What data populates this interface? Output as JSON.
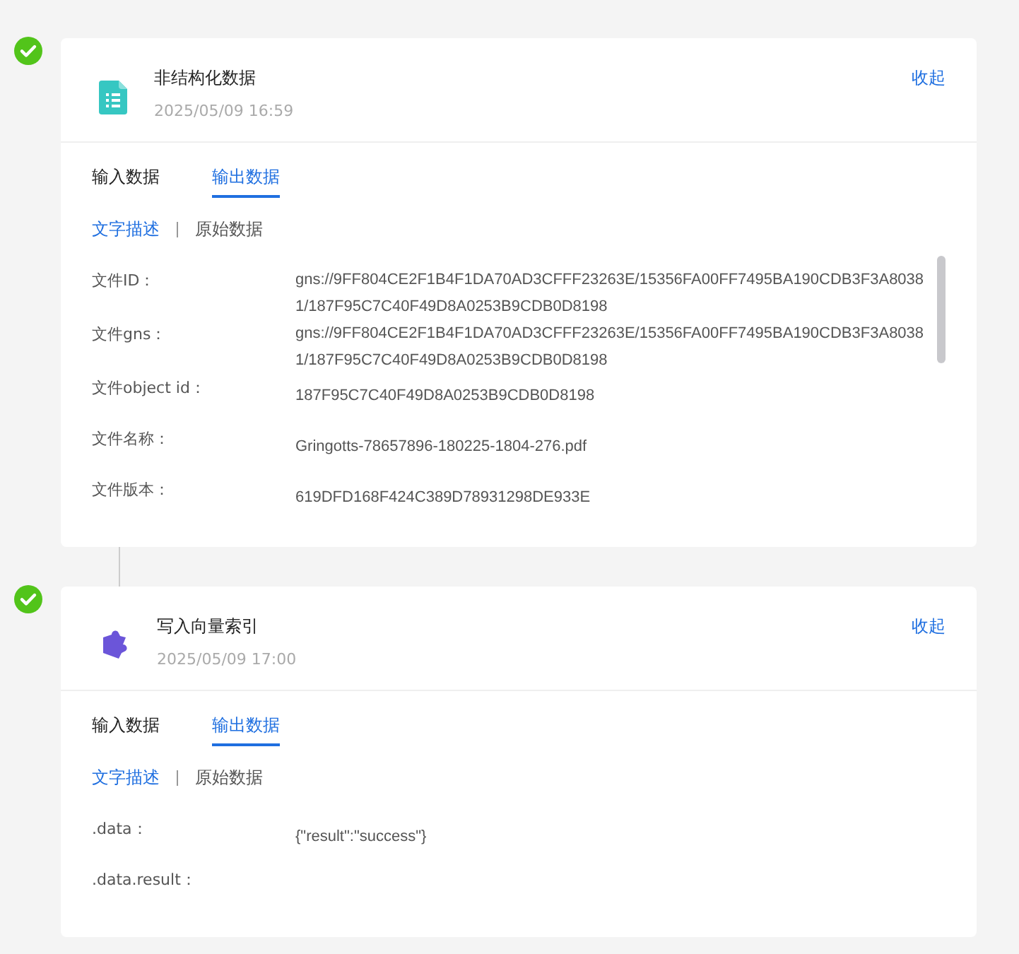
{
  "steps": [
    {
      "kind": "document",
      "title": "非结构化数据",
      "time": "2025/05/09 16:59",
      "toggle": "收起",
      "done": true,
      "tabs": [
        {
          "label": "输入数据",
          "selected": false
        },
        {
          "label": "输出数据",
          "selected": true
        }
      ],
      "subtabs": [
        {
          "label": "文字描述",
          "selected": true
        },
        {
          "label": "原始数据",
          "selected": false
        }
      ],
      "fields": [
        {
          "label": "文件ID：",
          "value": "gns://9FF804CE2F1B4F1DA70AD3CFFF23263E/15356FA00FF7495BA190CDB3F3A80381/187F95C7C40F49D8A0253B9CDB0D8198"
        },
        {
          "label": "文件gns：",
          "value": "gns://9FF804CE2F1B4F1DA70AD3CFFF23263E/15356FA00FF7495BA190CDB3F3A80381/187F95C7C40F49D8A0253B9CDB0D8198"
        },
        {
          "label": "文件object id：",
          "value": "187F95C7C40F49D8A0253B9CDB0D8198"
        },
        {
          "label": "文件名称：",
          "value": "Gringotts-78657896-180225-1804-276.pdf"
        },
        {
          "label": "文件版本：",
          "value": "619DFD168F424C389D78931298DE933E"
        }
      ]
    },
    {
      "kind": "puzzle",
      "title": "写入向量索引",
      "time": "2025/05/09 17:00",
      "toggle": "收起",
      "done": true,
      "tabs": [
        {
          "label": "输入数据",
          "selected": false
        },
        {
          "label": "输出数据",
          "selected": true
        }
      ],
      "subtabs": [
        {
          "label": "文字描述",
          "selected": true
        },
        {
          "label": "原始数据",
          "selected": false
        }
      ],
      "fields": [
        {
          "label": ".data：",
          "value": "{\"result\":\"success\"}"
        },
        {
          "label": ".data.result："
        }
      ]
    }
  ]
}
